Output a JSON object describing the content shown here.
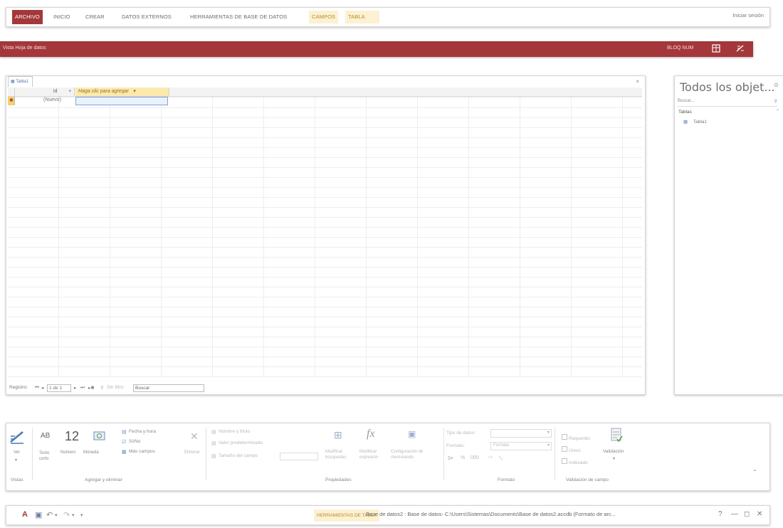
{
  "tabs": [
    "ARCHIVO",
    "INICIO",
    "CREAR",
    "DATOS EXTERNOS",
    "HERRAMIENTAS DE BASE DE DATOS",
    "CAMPOS",
    "TABLA"
  ],
  "signin": "Iniciar sesión",
  "status": {
    "left": "Vista Hoja de datos",
    "numlock": "BLOQ NUM"
  },
  "sheet": {
    "tab": "Tabla1",
    "col_id": "Id",
    "col_add": "Haga clic para agregar",
    "new_row": "(Nuevo)",
    "nav": {
      "label": "Registro:",
      "position": "1 de 1",
      "filter": "Sin filtro",
      "search": "Buscar"
    }
  },
  "navpane": {
    "title": "Todos los objet...",
    "search": "Buscar...",
    "section": "Tablas",
    "item": "Tabla1"
  },
  "ribbon": {
    "view": {
      "label": "Ver",
      "group": "Vistas"
    },
    "text": {
      "icon": "AB",
      "label": "Texto corto"
    },
    "number": {
      "icon": "12",
      "label": "Número"
    },
    "currency": {
      "label": "Moneda"
    },
    "date": "Fecha y hora",
    "yesno": "Sí/No",
    "more": "Más campos",
    "delete": "Eliminar",
    "add_group": "Agregar y eliminar",
    "name": "Nombre y título",
    "default": "Valor predeterminado",
    "size": "Tamaño del campo",
    "modify_lookups": "Modificar búsquedas",
    "modify_expr": "Modificar expresión",
    "memo": "Configuración de memorando",
    "props_group": "Propiedades",
    "datatype": "Tipo de datos:",
    "format": "Formato:",
    "format_val": "Formato",
    "format_group": "Formato",
    "required": "Requerido",
    "unique": "Único",
    "indexed": "Indexado",
    "validation": "Validación",
    "validation_group": "Validación de campo"
  },
  "titlebar": {
    "context": "HERRAMIENTAS DE TABLA",
    "title": "Base de datos2 : Base de datos- C:\\Users\\Sistemas\\Documents\\Base de datos2.accdb (Formato de arc..."
  }
}
